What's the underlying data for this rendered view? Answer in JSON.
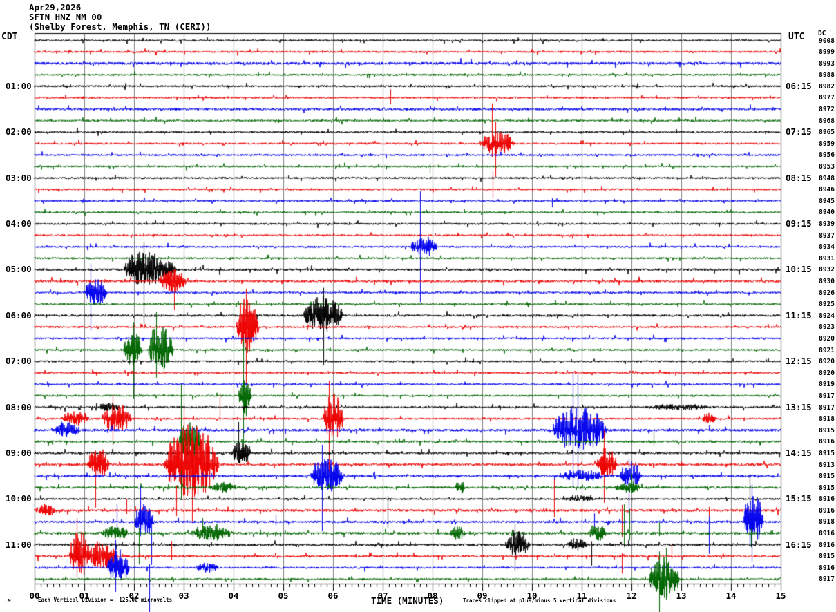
{
  "header": {
    "date": "Apr29,2026",
    "station": "SFTN HNZ NM 00",
    "location": "(Shelby Forest, Memphis, TN (CERI))"
  },
  "left_axis": {
    "title": "CDT",
    "labels": [
      {
        "row": 4,
        "text": "01:00"
      },
      {
        "row": 8,
        "text": "02:00"
      },
      {
        "row": 12,
        "text": "03:00"
      },
      {
        "row": 16,
        "text": "04:00"
      },
      {
        "row": 20,
        "text": "05:00"
      },
      {
        "row": 24,
        "text": "06:00"
      },
      {
        "row": 28,
        "text": "07:00"
      },
      {
        "row": 32,
        "text": "08:00"
      },
      {
        "row": 36,
        "text": "09:00"
      },
      {
        "row": 40,
        "text": "10:00"
      },
      {
        "row": 44,
        "text": "11:00"
      }
    ]
  },
  "right_axis": {
    "title": "UTC",
    "labels": [
      {
        "row": 4,
        "text": "06:15"
      },
      {
        "row": 8,
        "text": "07:15"
      },
      {
        "row": 12,
        "text": "08:15"
      },
      {
        "row": 16,
        "text": "09:15"
      },
      {
        "row": 20,
        "text": "10:15"
      },
      {
        "row": 24,
        "text": "11:15"
      },
      {
        "row": 28,
        "text": "12:15"
      },
      {
        "row": 32,
        "text": "13:15"
      },
      {
        "row": 36,
        "text": "14:15"
      },
      {
        "row": 40,
        "text": "15:15"
      },
      {
        "row": 44,
        "text": "16:15"
      }
    ]
  },
  "dc_column": {
    "title": "DC",
    "values": [
      "9008",
      "8999",
      "8993",
      "8988",
      "8982",
      "8977",
      "8972",
      "8968",
      "8965",
      "8959",
      "8956",
      "8953",
      "8948",
      "8946",
      "8945",
      "8940",
      "8939",
      "8937",
      "8934",
      "8931",
      "8932",
      "8930",
      "8926",
      "8925",
      "8924",
      "8923",
      "8920",
      "8921",
      "8920",
      "8920",
      "8919",
      "8917",
      "8917",
      "8918",
      "8915",
      "8916",
      "8915",
      "8913",
      "8915",
      "8915",
      "8916",
      "8916",
      "8918",
      "8916",
      "8916",
      "8915",
      "8916",
      "8917"
    ]
  },
  "x_axis": {
    "title": "TIME (MINUTES)",
    "tick_labels": [
      "00",
      "01",
      "02",
      "03",
      "04",
      "05",
      "06",
      "07",
      "08",
      "09",
      "10",
      "11",
      "12",
      "13",
      "14",
      "15"
    ]
  },
  "footer": {
    "left_mark": ".M",
    "left": "Each Vertical Division =  125.00 microvolts",
    "right": "Traces clipped at plus/minus 5 vertical divisions"
  },
  "colors": {
    "trace_cycle": [
      "#000000",
      "#ee0000",
      "#0000ee",
      "#006600"
    ],
    "grid": "#808080",
    "frame": "#000000",
    "background": "#ffffff"
  },
  "chart_data": {
    "type": "line",
    "kind": "helicorder-seismogram",
    "rows": 48,
    "minutes_per_row": 15,
    "row_interval_label": "15 minutes per trace line",
    "start_time_cdt": "00:00",
    "start_time_utc_label_step": "hourly, offset :15",
    "microvolts_per_division": 125.0,
    "clip_divisions": 5,
    "trace_color_cycle": [
      "black",
      "red",
      "blue",
      "green"
    ],
    "noise_mul": {
      "2": 1.4,
      "6": 1.2,
      "8": 1.1,
      "20": 1.3,
      "21": 1.2,
      "24": 1.2,
      "32": 1.1,
      "34": 1.4,
      "35": 1.2,
      "36": 1.2,
      "37": 1.2,
      "38": 1.3,
      "39": 1.2,
      "41": 1.3,
      "42": 1.2,
      "43": 1.4,
      "44": 1.3,
      "45": 1.2
    },
    "bursts": [
      {
        "row": 9,
        "t": 8.95,
        "dur": 0.7,
        "amp": 18
      },
      {
        "row": 18,
        "t": 7.55,
        "dur": 0.55,
        "amp": 16
      },
      {
        "row": 20,
        "t": 1.8,
        "dur": 0.8,
        "amp": 30
      },
      {
        "row": 20,
        "t": 2.45,
        "dur": 0.4,
        "amp": 14
      },
      {
        "row": 21,
        "t": 2.5,
        "dur": 0.55,
        "amp": 20
      },
      {
        "row": 22,
        "t": 1.0,
        "dur": 0.45,
        "amp": 22
      },
      {
        "row": 24,
        "t": 5.4,
        "dur": 0.8,
        "amp": 30
      },
      {
        "row": 25,
        "t": 4.05,
        "dur": 0.45,
        "amp": 45
      },
      {
        "row": 27,
        "t": 1.78,
        "dur": 0.38,
        "amp": 28
      },
      {
        "row": 27,
        "t": 2.28,
        "dur": 0.5,
        "amp": 40
      },
      {
        "row": 31,
        "t": 4.1,
        "dur": 0.25,
        "amp": 35
      },
      {
        "row": 32,
        "t": 1.3,
        "dur": 0.4,
        "amp": 8
      },
      {
        "row": 32,
        "t": 12.3,
        "dur": 1.3,
        "amp": 4
      },
      {
        "row": 33,
        "t": 0.55,
        "dur": 0.55,
        "amp": 12
      },
      {
        "row": 33,
        "t": 1.35,
        "dur": 0.6,
        "amp": 25
      },
      {
        "row": 33,
        "t": 5.8,
        "dur": 0.4,
        "amp": 40
      },
      {
        "row": 33,
        "t": 13.4,
        "dur": 0.3,
        "amp": 9
      },
      {
        "row": 34,
        "t": 0.4,
        "dur": 0.5,
        "amp": 13
      },
      {
        "row": 34,
        "t": 10.4,
        "dur": 1.1,
        "amp": 35
      },
      {
        "row": 35,
        "t": 2.9,
        "dur": 0.45,
        "amp": 30
      },
      {
        "row": 36,
        "t": 3.95,
        "dur": 0.4,
        "amp": 18
      },
      {
        "row": 37,
        "t": 1.05,
        "dur": 0.45,
        "amp": 25
      },
      {
        "row": 37,
        "t": 2.6,
        "dur": 1.1,
        "amp": 60
      },
      {
        "row": 37,
        "t": 11.3,
        "dur": 0.4,
        "amp": 25
      },
      {
        "row": 38,
        "t": 5.55,
        "dur": 0.65,
        "amp": 28
      },
      {
        "row": 38,
        "t": 10.55,
        "dur": 0.9,
        "amp": 9
      },
      {
        "row": 38,
        "t": 11.75,
        "dur": 0.45,
        "amp": 20
      },
      {
        "row": 39,
        "t": 3.5,
        "dur": 0.55,
        "amp": 8
      },
      {
        "row": 39,
        "t": 8.45,
        "dur": 0.2,
        "amp": 10
      },
      {
        "row": 39,
        "t": 11.65,
        "dur": 0.55,
        "amp": 9
      },
      {
        "row": 40,
        "t": 10.65,
        "dur": 0.6,
        "amp": 5
      },
      {
        "row": 41,
        "t": 0.02,
        "dur": 0.4,
        "amp": 9
      },
      {
        "row": 42,
        "t": 2.0,
        "dur": 0.4,
        "amp": 28
      },
      {
        "row": 42,
        "t": 14.25,
        "dur": 0.4,
        "amp": 45
      },
      {
        "row": 43,
        "t": 1.3,
        "dur": 0.6,
        "amp": 10
      },
      {
        "row": 43,
        "t": 3.15,
        "dur": 0.85,
        "amp": 13
      },
      {
        "row": 43,
        "t": 8.35,
        "dur": 0.3,
        "amp": 11
      },
      {
        "row": 43,
        "t": 11.15,
        "dur": 0.35,
        "amp": 13
      },
      {
        "row": 44,
        "t": 9.45,
        "dur": 0.5,
        "amp": 22
      },
      {
        "row": 44,
        "t": 10.7,
        "dur": 0.4,
        "amp": 10
      },
      {
        "row": 45,
        "t": 0.7,
        "dur": 0.4,
        "amp": 40
      },
      {
        "row": 45,
        "t": 1.05,
        "dur": 0.6,
        "amp": 22
      },
      {
        "row": 46,
        "t": 1.45,
        "dur": 0.45,
        "amp": 28
      },
      {
        "row": 46,
        "t": 3.25,
        "dur": 0.45,
        "amp": 8
      },
      {
        "row": 47,
        "t": 12.35,
        "dur": 0.6,
        "amp": 35
      }
    ],
    "spikes": [
      {
        "row": 5,
        "t": 7.15,
        "up": 12,
        "down": 9
      },
      {
        "row": 9,
        "t": 9.2,
        "up": 58,
        "down": 20
      },
      {
        "row": 9,
        "t": 9.26,
        "up": 32,
        "down": 48
      },
      {
        "row": 11,
        "t": 7.95,
        "up": 4,
        "down": 10
      },
      {
        "row": 13,
        "t": 9.21,
        "up": 26,
        "down": 12
      },
      {
        "row": 14,
        "t": 10.4,
        "up": 4,
        "down": 9
      },
      {
        "row": 18,
        "t": 7.75,
        "up": 80,
        "down": 80
      },
      {
        "row": 20,
        "t": 2.2,
        "up": 40,
        "down": 78
      },
      {
        "row": 21,
        "t": 2.8,
        "up": 16,
        "down": 42
      },
      {
        "row": 22,
        "t": 1.13,
        "up": 42,
        "down": 55
      },
      {
        "row": 24,
        "t": 5.8,
        "up": 40,
        "down": 72
      },
      {
        "row": 25,
        "t": 4.25,
        "up": 55,
        "down": 83
      },
      {
        "row": 27,
        "t": 1.98,
        "up": 40,
        "down": 70
      },
      {
        "row": 27,
        "t": 2.45,
        "up": 55,
        "down": 40
      },
      {
        "row": 31,
        "t": 4.2,
        "up": 83,
        "down": 83
      },
      {
        "row": 33,
        "t": 1.57,
        "up": 35,
        "down": 38
      },
      {
        "row": 33,
        "t": 3.72,
        "up": 36,
        "down": 4
      },
      {
        "row": 33,
        "t": 5.92,
        "up": 55,
        "down": 78
      },
      {
        "row": 34,
        "t": 10.82,
        "up": 83,
        "down": 83
      },
      {
        "row": 34,
        "t": 10.92,
        "up": 80,
        "down": 83
      },
      {
        "row": 35,
        "t": 2.95,
        "up": 83,
        "down": 83
      },
      {
        "row": 35,
        "t": 12.45,
        "up": 14,
        "down": 5
      },
      {
        "row": 36,
        "t": 4.1,
        "up": 45,
        "down": 12
      },
      {
        "row": 37,
        "t": 1.22,
        "up": 20,
        "down": 62
      },
      {
        "row": 37,
        "t": 3.0,
        "up": 83,
        "down": 83
      },
      {
        "row": 37,
        "t": 3.17,
        "up": 55,
        "down": 83
      },
      {
        "row": 37,
        "t": 11.45,
        "up": 50,
        "down": 55
      },
      {
        "row": 38,
        "t": 5.78,
        "up": 45,
        "down": 80
      },
      {
        "row": 38,
        "t": 11.95,
        "up": 25,
        "down": 55
      },
      {
        "row": 39,
        "t": 12.0,
        "up": 20,
        "down": 8
      },
      {
        "row": 40,
        "t": 7.1,
        "up": 4,
        "down": 42
      },
      {
        "row": 40,
        "t": 14.38,
        "up": 36,
        "down": 6
      },
      {
        "row": 41,
        "t": 1.85,
        "up": 16,
        "down": 5
      },
      {
        "row": 41,
        "t": 2.85,
        "up": 36,
        "down": 8
      },
      {
        "row": 41,
        "t": 10.45,
        "up": 45,
        "down": 10
      },
      {
        "row": 41,
        "t": 11.8,
        "up": 8,
        "down": 38
      },
      {
        "row": 41,
        "t": 13.55,
        "up": 5,
        "down": 20
      },
      {
        "row": 42,
        "t": 1.65,
        "up": 26,
        "down": 8
      },
      {
        "row": 42,
        "t": 2.12,
        "up": 52,
        "down": 12
      },
      {
        "row": 42,
        "t": 2.35,
        "up": 8,
        "down": 62
      },
      {
        "row": 42,
        "t": 4.85,
        "up": 10,
        "down": 5
      },
      {
        "row": 42,
        "t": 11.25,
        "up": 12,
        "down": 8
      },
      {
        "row": 42,
        "t": 13.55,
        "up": 8,
        "down": 46
      },
      {
        "row": 42,
        "t": 14.42,
        "up": 55,
        "down": 58
      },
      {
        "row": 43,
        "t": 2.1,
        "up": 8,
        "down": 45
      },
      {
        "row": 43,
        "t": 3.38,
        "up": 22,
        "down": 6
      },
      {
        "row": 43,
        "t": 11.85,
        "up": 42,
        "down": 20
      },
      {
        "row": 43,
        "t": 11.96,
        "up": 35,
        "down": 10
      },
      {
        "row": 43,
        "t": 12.55,
        "up": 16,
        "down": 4
      },
      {
        "row": 43,
        "t": 14.4,
        "up": 8,
        "down": 20
      },
      {
        "row": 44,
        "t": 9.65,
        "up": 30,
        "down": 38
      },
      {
        "row": 44,
        "t": 11.2,
        "up": 5,
        "down": 30
      },
      {
        "row": 45,
        "t": 0.85,
        "up": 55,
        "down": 30
      },
      {
        "row": 45,
        "t": 2.75,
        "up": 22,
        "down": 5
      },
      {
        "row": 45,
        "t": 11.8,
        "up": 4,
        "down": 25
      },
      {
        "row": 45,
        "t": 12.8,
        "up": 18,
        "down": 4
      },
      {
        "row": 46,
        "t": 1.62,
        "up": 40,
        "down": 35
      },
      {
        "row": 46,
        "t": 2.3,
        "up": 5,
        "down": 70
      },
      {
        "row": 47,
        "t": 12.55,
        "up": 40,
        "down": 50
      },
      {
        "row": 47,
        "t": 12.7,
        "up": 45,
        "down": 30
      }
    ]
  }
}
